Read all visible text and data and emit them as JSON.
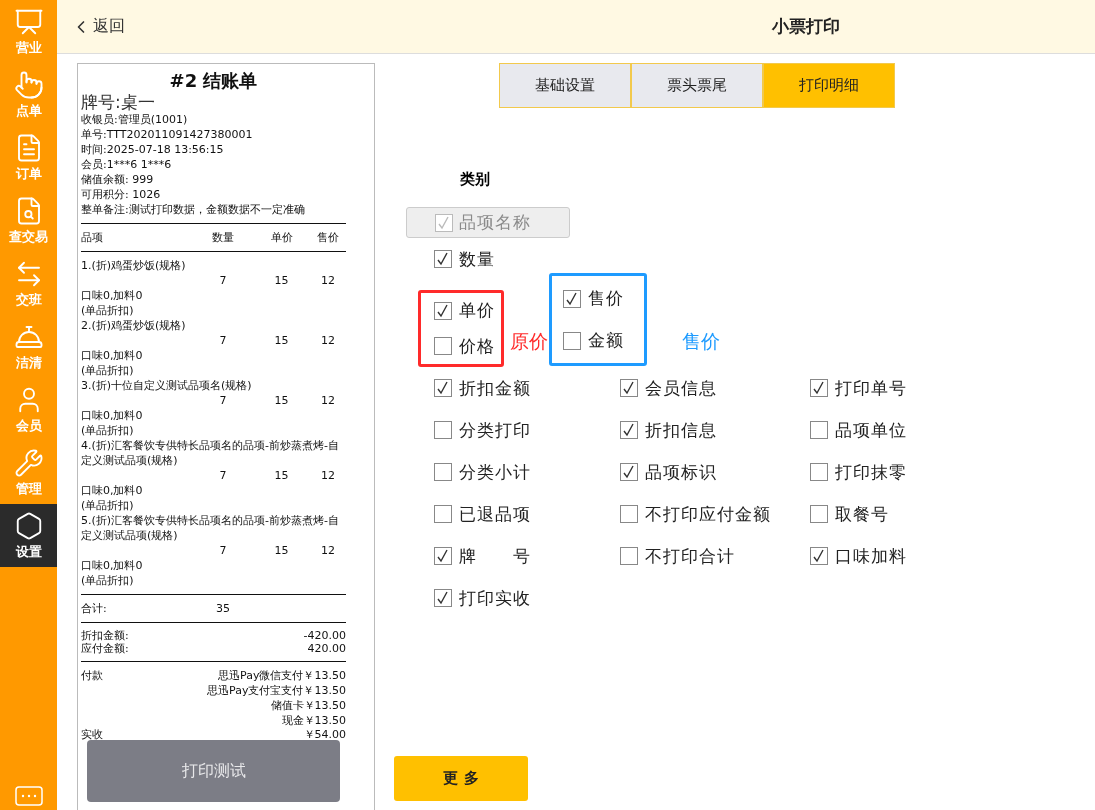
{
  "sidebar": {
    "items": [
      {
        "label": "营业",
        "selected": false
      },
      {
        "label": "点单",
        "selected": false
      },
      {
        "label": "订单",
        "selected": false
      },
      {
        "label": "查交易",
        "selected": false
      },
      {
        "label": "交班",
        "selected": false
      },
      {
        "label": "洁清",
        "selected": false
      },
      {
        "label": "会员",
        "selected": false
      },
      {
        "label": "管理",
        "selected": false
      },
      {
        "label": "设置",
        "selected": true
      }
    ]
  },
  "header": {
    "back": "返回",
    "title": "小票打印"
  },
  "receipt": {
    "title": "#2 结账单",
    "table_no": "牌号:桌一",
    "info": [
      "收银员:管理员(1001)",
      "单号:TTT202011091427380001",
      "时间:2025-07-18 13:56:15",
      "会员:1***6  1***6",
      "储值余额: 999",
      "可用积分: 1026",
      "整单备注:测试打印数据，金额数据不一定准确"
    ],
    "columns": [
      "品项",
      "数量",
      "单价",
      "售价"
    ],
    "items": [
      {
        "name": "1.(折)鸡蛋炒饭(规格)",
        "qty": "7",
        "unit_price": "15",
        "price": "12",
        "flavor": "口味0,加料0",
        "note": "(单品折扣)"
      },
      {
        "name": "2.(折)鸡蛋炒饭(规格)",
        "qty": "7",
        "unit_price": "15",
        "price": "12",
        "flavor": "口味0,加料0",
        "note": "(单品折扣)"
      },
      {
        "name": "3.(折)十位自定义测试品项名(规格)",
        "qty": "7",
        "unit_price": "15",
        "price": "12",
        "flavor": "口味0,加料0",
        "note": "(单品折扣)"
      },
      {
        "name": "4.(折)汇客餐饮专供特长品项名的品项-前炒蒸煮烤-自定义测试品项(规格)",
        "qty": "7",
        "unit_price": "15",
        "price": "12",
        "flavor": "口味0,加料0",
        "note": "(单品折扣)"
      },
      {
        "name": "5.(折)汇客餐饮专供特长品项名的品项-前炒蒸煮烤-自定义测试品项(规格)",
        "qty": "7",
        "unit_price": "15",
        "price": "12",
        "flavor": "口味0,加料0",
        "note": "(单品折扣)"
      }
    ],
    "total": {
      "label": "合计:",
      "value": "35"
    },
    "amounts": [
      {
        "label": "折扣金额:",
        "value": "-420.00"
      },
      {
        "label": "应付金额:",
        "value": "420.00"
      }
    ],
    "payment_label": "付款",
    "payments": [
      "思迅Pay微信支付￥13.50",
      "思迅Pay支付宝支付￥13.50",
      "储值卡￥13.50",
      "现金￥13.50"
    ],
    "paid": {
      "label": "实收",
      "value": "￥54.00"
    }
  },
  "print_test_button": "打印测试",
  "tabs": [
    {
      "label": "基础设置",
      "selected": false
    },
    {
      "label": "票头票尾",
      "selected": false
    },
    {
      "label": "打印明细",
      "selected": true
    }
  ],
  "category_label": "类别",
  "fixed_option": {
    "label": "品项名称",
    "checked": true,
    "disabled": true
  },
  "quantity_option": {
    "label": "数量",
    "checked": true
  },
  "original_price_group": {
    "caption": "原价",
    "options": [
      {
        "label": "单价",
        "checked": true
      },
      {
        "label": "价格",
        "checked": false
      }
    ]
  },
  "sale_price_group": {
    "caption": "售价",
    "options": [
      {
        "label": "售价",
        "checked": true
      },
      {
        "label": "金额",
        "checked": false
      }
    ]
  },
  "options": [
    {
      "label": "折扣金额",
      "checked": true
    },
    {
      "label": "会员信息",
      "checked": true
    },
    {
      "label": "打印单号",
      "checked": true
    },
    {
      "label": "分类打印",
      "checked": false
    },
    {
      "label": "折扣信息",
      "checked": true
    },
    {
      "label": "品项单位",
      "checked": false
    },
    {
      "label": "分类小计",
      "checked": false
    },
    {
      "label": "品项标识",
      "checked": true
    },
    {
      "label": "打印抹零",
      "checked": false
    },
    {
      "label": "已退品项",
      "checked": false
    },
    {
      "label": "不打印应付金额",
      "checked": false
    },
    {
      "label": "取餐号",
      "checked": false
    },
    {
      "label": "牌　　号",
      "checked": true
    },
    {
      "label": "不打印合计",
      "checked": false
    },
    {
      "label": "口味加料",
      "checked": true
    },
    {
      "label": "打印实收",
      "checked": true
    }
  ],
  "more_button": "更 多"
}
